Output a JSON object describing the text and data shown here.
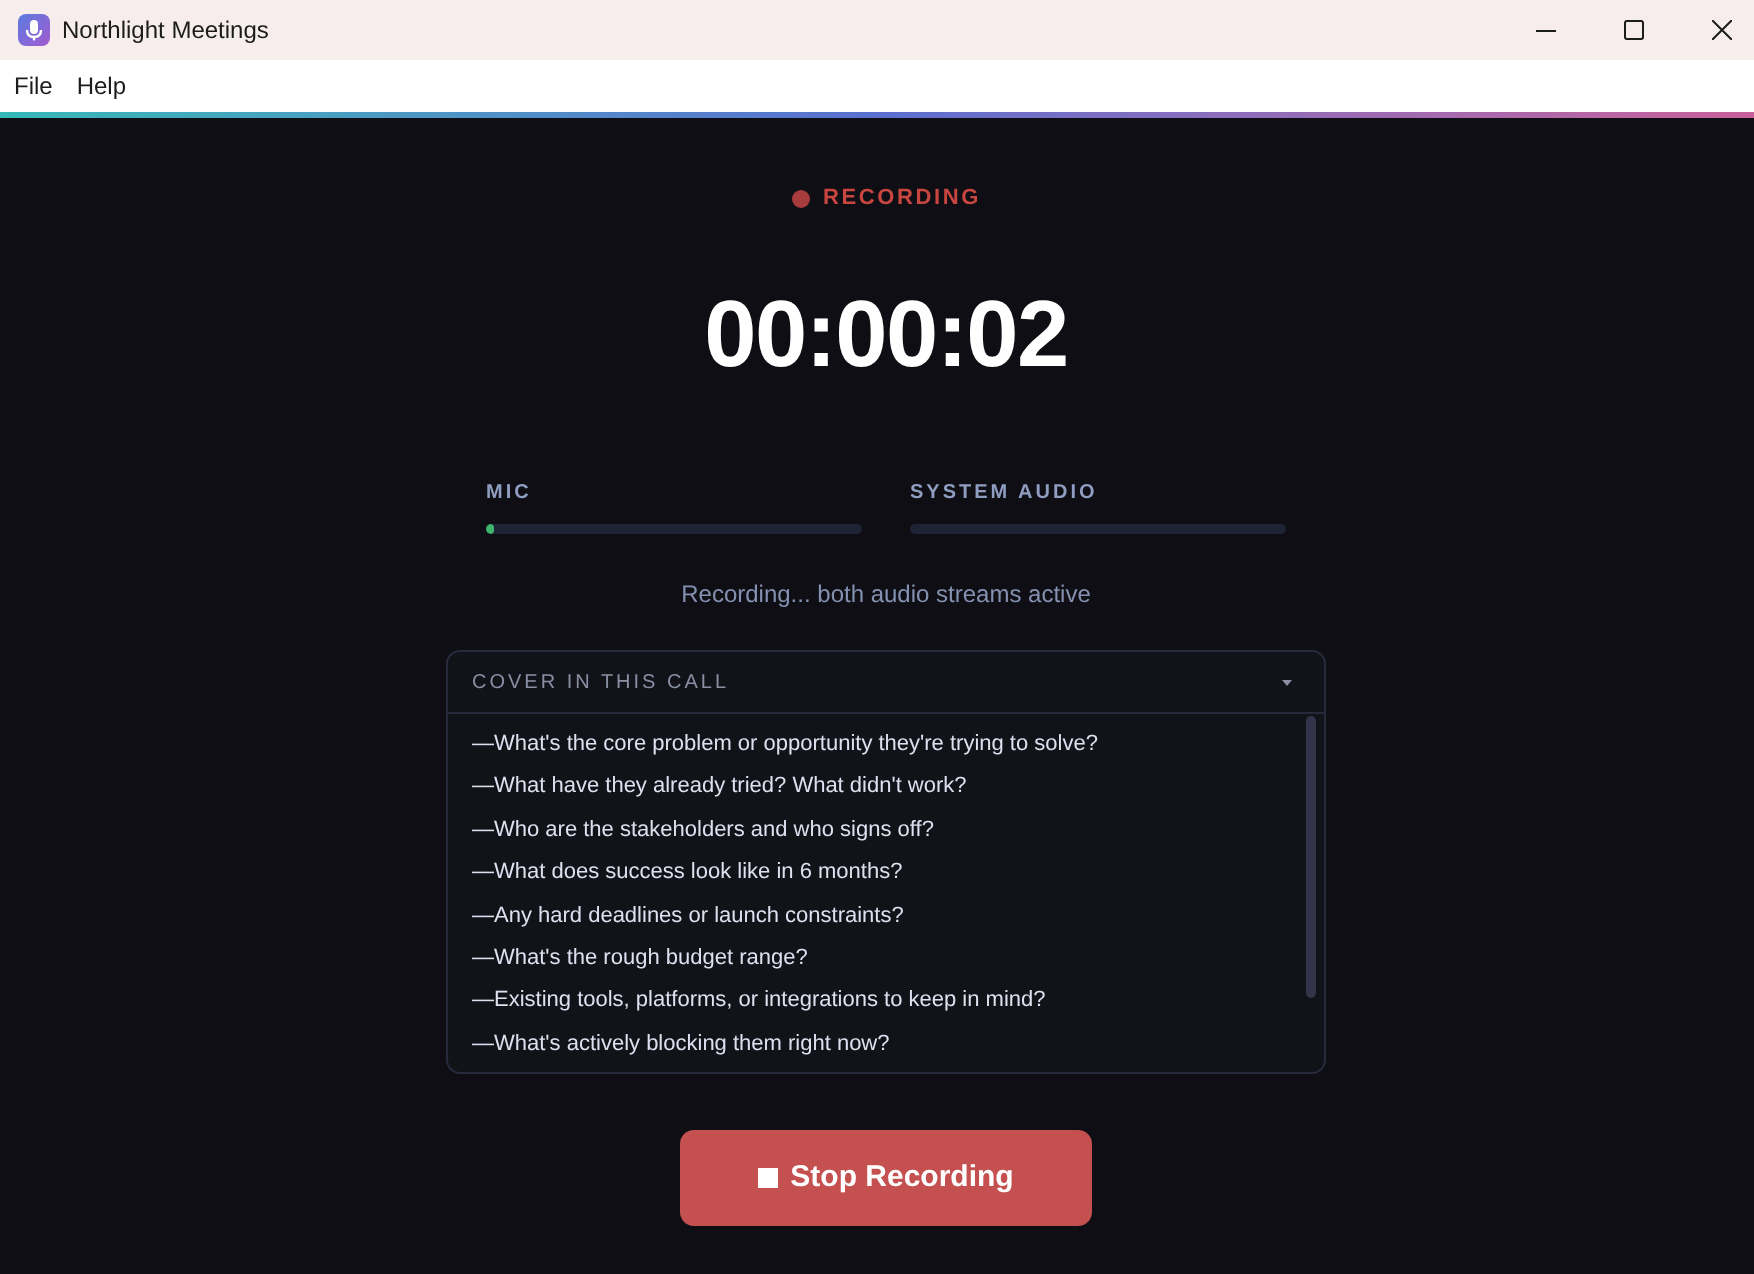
{
  "window": {
    "title": "Northlight Meetings"
  },
  "menu": [
    "File",
    "Help"
  ],
  "recording": {
    "on": true,
    "label": "RECORDING"
  },
  "timer": "00:00:02",
  "meters": [
    {
      "label": "MIC",
      "level": 0.02
    },
    {
      "label": "SYSTEM AUDIO"
    }
  ],
  "status": "Recording... both audio streams active",
  "checklist": {
    "title": "COVER IN THIS CALL",
    "expanded": true,
    "items": [
      "—What's the core problem or opportunity they're trying to solve?",
      "—What have they already tried? What didn't work?",
      "—Who are the stakeholders and who signs off?",
      "—What does success look like in 6 months?",
      "—Any hard deadlines or launch constraints?",
      "—What's the rough budget range?",
      "—Existing tools, platforms, or integrations to keep in mind?",
      "—What's actively blocking them right now?"
    ]
  },
  "stop_button": {
    "label": "Stop Recording"
  }
}
